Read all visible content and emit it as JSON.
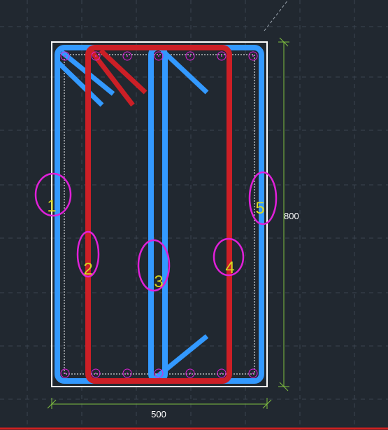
{
  "canvas": {
    "background": "#212830",
    "grid_color": "#3a4450"
  },
  "colors": {
    "section_outline": "#ffffff",
    "cover_line": "#ffffff",
    "blue_rebar": "#3399ff",
    "red_rebar": "#cc1f26",
    "marker": "#e020d8",
    "label_text": "#d8d820",
    "dimension": "#7fbf3f",
    "dimension_text": "#ffffff",
    "bottom_edge": "#cc2020"
  },
  "dimensions": {
    "width_label": "500",
    "height_label": "800"
  },
  "markers": [
    {
      "id": "1",
      "label": "1"
    },
    {
      "id": "2",
      "label": "2"
    },
    {
      "id": "3",
      "label": "3"
    },
    {
      "id": "4",
      "label": "4"
    },
    {
      "id": "5",
      "label": "5"
    }
  ]
}
